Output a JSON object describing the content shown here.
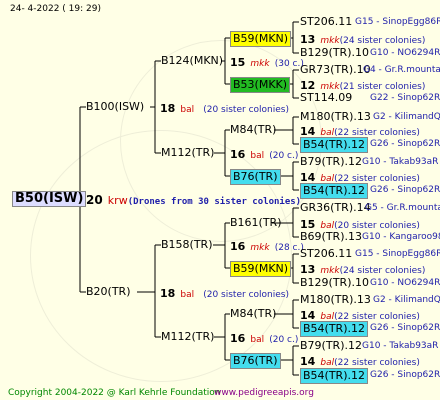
{
  "header": {
    "date": "24-  4-2022 ( 19: 29)"
  },
  "root": {
    "label": "B50(ISW)"
  },
  "mating": {
    "num": "20",
    "race": "krw",
    "desc": "(Drones from 30 sister colonies)"
  },
  "g1": [
    {
      "label": "B100(ISW)",
      "num": "18",
      "race": "bal",
      "desc": "(20 sister colonies)"
    },
    {
      "label": "B20(TR)",
      "num": "18",
      "race": "bal",
      "desc": "(20 sister colonies)"
    }
  ],
  "g2": [
    {
      "label": "B124(MKN)",
      "num": "15",
      "race": "mkk",
      "desc": "(30 c.)"
    },
    {
      "label": "M112(TR)",
      "num": "16",
      "race": "bal",
      "desc": "(20 c.)"
    },
    {
      "label": "B158(TR)",
      "num": "16",
      "race": "mkk",
      "desc": "(28 c.)"
    },
    {
      "label": "M112(TR)",
      "num": "16",
      "race": "bal",
      "desc": "(20 c.)"
    }
  ],
  "g3": [
    {
      "label": "B59(MKN)",
      "num": "13",
      "race": "mkk",
      "desc": "(24 sister colonies)"
    },
    {
      "label": "B53(MKK)",
      "num": "12",
      "race": "mkk",
      "desc": "(21 sister colonies)"
    },
    {
      "label": "M84(TR)",
      "num": "14",
      "race": "bal",
      "desc": "(22 sister colonies)"
    },
    {
      "label": "B76(TR)",
      "num": "14",
      "race": "bal",
      "desc": "(22 sister colonies)"
    },
    {
      "label": "B161(TR)",
      "num": "15",
      "race": "bal",
      "desc": "(20 sister colonies)"
    },
    {
      "label": "B59(MKN)",
      "num": "13",
      "race": "mkk",
      "desc": "(24 sister colonies)"
    },
    {
      "label": "M84(TR)",
      "num": "14",
      "race": "bal",
      "desc": "(22 sister colonies)"
    },
    {
      "label": "B76(TR)",
      "num": "14",
      "race": "bal",
      "desc": "(22 sister colonies)"
    }
  ],
  "g4": [
    {
      "label": "ST206.11",
      "info": "G15 - SinopEgg86R"
    },
    {
      "label": "B129(TR).10",
      "info": "G10 - NO6294R"
    },
    {
      "label": "GR73(TR).10",
      "info": "G4 - Gr.R.mounta"
    },
    {
      "label": "ST114.09",
      "info": "G22 - Sinop62R"
    },
    {
      "label": "M180(TR).13",
      "info": "G2 - KilimandQ"
    },
    {
      "label": "B54(TR).12",
      "info": "G26 - Sinop62R"
    },
    {
      "label": "B79(TR).12",
      "info": "G10 - Takab93aR"
    },
    {
      "label": "B54(TR).12",
      "info": "G26 - Sinop62R"
    },
    {
      "label": "GR36(TR).14",
      "info": "G5 - Gr.R.mounta"
    },
    {
      "label": "B69(TR).13",
      "info": "G10 - Kangaroo98R"
    },
    {
      "label": "ST206.11",
      "info": "G15 - SinopEgg86R"
    },
    {
      "label": "B129(TR).10",
      "info": "G10 - NO6294R"
    },
    {
      "label": "M180(TR).13",
      "info": "G2 - KilimandQ"
    },
    {
      "label": "B54(TR).12",
      "info": "G26 - Sinop62R"
    },
    {
      "label": "B79(TR).12",
      "info": "G10 - Takab93aR"
    },
    {
      "label": "B54(TR).12",
      "info": "G26 - Sinop62R"
    }
  ],
  "footer": {
    "copyright": "Copyright 2004-2022 @ Karl Kehrle Foundation",
    "url": "www.pedigreeapis.org"
  },
  "colors": {
    "background": "#ffffe6",
    "line": "#000000",
    "yellow_box": "#ffff00",
    "green_box": "#22bb22",
    "cyan_box": "#44ddee",
    "race_text": "#cc0000",
    "info_text": "#1f1faa",
    "footer_green": "#008800",
    "footer_purple": "#880088"
  }
}
